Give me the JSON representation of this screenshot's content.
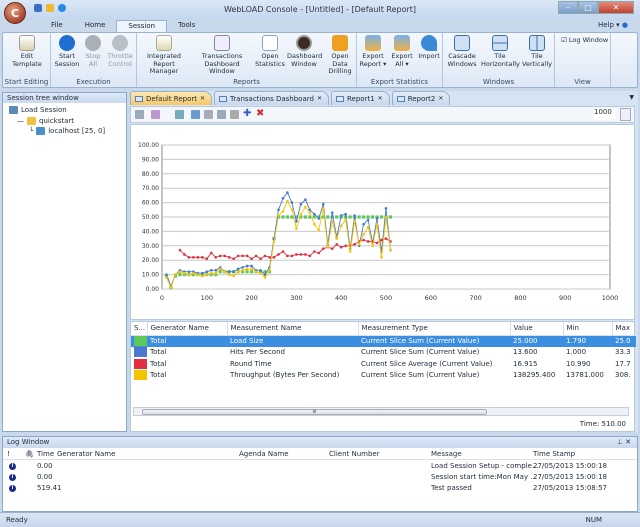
{
  "window": {
    "title": "WebLOAD Console - [Untitled] - [Default Report]",
    "app_orb": "C",
    "help_label": "Help"
  },
  "menu_tabs": [
    "File",
    "Home",
    "Session",
    "Tools"
  ],
  "active_menu_tab": "Session",
  "ribbon": {
    "groups": [
      {
        "label": "Start Editing",
        "buttons": [
          {
            "label": "Edit\nTemplate",
            "icon": "edit-template-icon",
            "enabled": true
          }
        ]
      },
      {
        "label": "Execution",
        "buttons": [
          {
            "label": "Start\nSession",
            "icon": "play-icon",
            "enabled": true
          },
          {
            "label": "Stop\nAll",
            "icon": "stop-icon",
            "enabled": false
          },
          {
            "label": "Throttle\nControl",
            "icon": "throttle-icon",
            "enabled": false
          }
        ]
      },
      {
        "label": "Reports",
        "buttons": [
          {
            "label": "Integrated\nReport Manager",
            "icon": "report-manager-icon",
            "enabled": true
          },
          {
            "label": "Transactions\nDashboard Window",
            "icon": "dashboard-chart-icon",
            "enabled": true
          },
          {
            "label": "Open\nStatistics",
            "icon": "statistics-icon",
            "enabled": true
          },
          {
            "label": "Dashboard\nWindow",
            "icon": "gauge-icon",
            "enabled": true
          },
          {
            "label": "Open Data\nDrilling",
            "icon": "drill-icon",
            "enabled": true
          }
        ]
      },
      {
        "label": "Export Statistics",
        "buttons": [
          {
            "label": "Export\nReport ▾",
            "icon": "export-report-icon",
            "enabled": true
          },
          {
            "label": "Export\nAll ▾",
            "icon": "export-all-icon",
            "enabled": true
          },
          {
            "label": "Import",
            "icon": "import-icon",
            "enabled": true
          }
        ]
      },
      {
        "label": "Windows",
        "buttons": [
          {
            "label": "Cascade\nWindows",
            "icon": "cascade-icon",
            "enabled": true
          },
          {
            "label": "Tile\nHorizontally",
            "icon": "tile-horizontal-icon",
            "enabled": true
          },
          {
            "label": "Tile\nVertically",
            "icon": "tile-vertical-icon",
            "enabled": true
          }
        ]
      },
      {
        "label": "View",
        "buttons": []
      }
    ],
    "log_window_checkbox": {
      "label": "Log Window",
      "checked": true
    }
  },
  "session_tree": {
    "title": "Session tree window",
    "items": [
      "Load Session",
      "quickstart",
      "localhost [25, 0]"
    ]
  },
  "doc_tabs": [
    "Default Report",
    "Transactions Dashboard",
    "Report1",
    "Report2"
  ],
  "active_doc_tab": "Default Report",
  "toolbar": {
    "zoom_value": "1000"
  },
  "chart_data": {
    "type": "line",
    "xlim": [
      0,
      1000
    ],
    "ylim": [
      0,
      100
    ],
    "x_ticks": [
      "0",
      "100",
      "200",
      "300",
      "400",
      "500",
      "600",
      "700",
      "800",
      "900",
      "1000"
    ],
    "y_ticks": [
      "0.00",
      "10.00",
      "20.00",
      "30.00",
      "40.00",
      "50.00",
      "60.00",
      "70.00",
      "80.00",
      "90.00",
      "100.00"
    ],
    "grid": true,
    "x": [
      10,
      20,
      30,
      40,
      50,
      60,
      70,
      80,
      90,
      100,
      110,
      120,
      130,
      140,
      150,
      160,
      170,
      180,
      190,
      200,
      210,
      220,
      230,
      240,
      250,
      260,
      270,
      280,
      290,
      300,
      310,
      320,
      330,
      340,
      350,
      360,
      370,
      380,
      390,
      400,
      410,
      420,
      430,
      440,
      450,
      460,
      470,
      480,
      490,
      500,
      510
    ],
    "series": [
      {
        "name": "Load Size",
        "color": "#5cc85c",
        "values": [
          9,
          1,
          9,
          10,
          10,
          10,
          10,
          10,
          10,
          10,
          10,
          10,
          12,
          12,
          12,
          12,
          12,
          12,
          12,
          12,
          12,
          12,
          12,
          12,
          35,
          50,
          50,
          50,
          50,
          50,
          50,
          50,
          50,
          50,
          50,
          50,
          50,
          50,
          50,
          50,
          50,
          50,
          50,
          50,
          50,
          50,
          50,
          50,
          50,
          50,
          50
        ]
      },
      {
        "name": "Hits Per Second",
        "color": "#4a78d0",
        "values": [
          10,
          2,
          10,
          13,
          12,
          12,
          12,
          11,
          11,
          12,
          13,
          13,
          15,
          12,
          12,
          12,
          14,
          15,
          16,
          16,
          13,
          13,
          10,
          15,
          35,
          55,
          63,
          67,
          60,
          47,
          59,
          62,
          55,
          52,
          49,
          59,
          31,
          53,
          36,
          51,
          52,
          28,
          51,
          30,
          45,
          48,
          32,
          49,
          26,
          56,
          27
        ]
      },
      {
        "name": "Round Time",
        "color": "#e03040",
        "values": [
          null,
          null,
          null,
          27,
          24,
          22,
          22,
          22,
          22,
          21,
          25,
          22,
          23,
          23,
          22,
          21,
          23,
          23,
          23,
          21,
          23,
          21,
          23,
          22,
          22,
          24,
          26,
          23,
          23,
          24,
          24,
          24,
          23,
          26,
          25,
          28,
          29,
          28,
          31,
          29,
          30,
          30,
          31,
          33,
          34,
          33,
          33,
          32,
          34,
          35,
          33
        ]
      },
      {
        "name": "Throughput (Bytes Per Second)",
        "color": "#f5c400",
        "values": [
          8,
          1,
          10,
          12,
          11,
          10,
          11,
          10,
          9,
          10,
          11,
          11,
          14,
          12,
          10,
          9,
          12,
          13,
          14,
          14,
          12,
          11,
          8,
          13,
          33,
          51,
          54,
          61,
          55,
          42,
          52,
          57,
          53,
          45,
          41,
          56,
          29,
          47,
          35,
          44,
          48,
          26,
          47,
          31,
          38,
          43,
          30,
          45,
          22,
          50,
          27
        ]
      }
    ]
  },
  "measurements": {
    "columns": [
      "S...",
      "Generator Name",
      "Measurement Name",
      "Measurement Type",
      "Value",
      "Min",
      "Max"
    ],
    "rows": [
      {
        "color": "#5cc85c",
        "generator": "Total",
        "name": "Load Size",
        "type": "Current Slice Sum (Current Value)",
        "value": "25.000",
        "min": "1.790",
        "max": "25.0"
      },
      {
        "color": "#4a78d0",
        "generator": "Total",
        "name": "Hits Per Second",
        "type": "Current Slice Sum (Current Value)",
        "value": "13.600",
        "min": "1.000",
        "max": "33.3"
      },
      {
        "color": "#e03040",
        "generator": "Total",
        "name": "Round Time",
        "type": "Current Slice Average (Current Value)",
        "value": "16.915",
        "min": "10.990",
        "max": "17.7"
      },
      {
        "color": "#f5c400",
        "generator": "Total",
        "name": "Throughput (Bytes Per Second)",
        "type": "Current Slice Sum (Current Value)",
        "value": "138295.400",
        "min": "13781.000",
        "max": "308."
      }
    ],
    "selected_row": 0,
    "time_label": "Time: 510.00"
  },
  "log_window": {
    "title": "Log Window",
    "columns": [
      "!",
      "",
      "Time",
      "Generator Name",
      "Agenda Name",
      "Client Number",
      "Message",
      "Time Stamp"
    ],
    "rows": [
      {
        "time": "0.00",
        "message": "Load Session Setup - comple...",
        "timestamp": "27/05/2013 15:00:18"
      },
      {
        "time": "0.00",
        "message": "Session start time:Mon May ...",
        "timestamp": "27/05/2013 15:00:18"
      },
      {
        "time": "519.41",
        "message": "Test passed",
        "timestamp": "27/05/2013 15:08:57"
      }
    ]
  },
  "status_bar": {
    "left": "Ready",
    "num": "NUM"
  }
}
